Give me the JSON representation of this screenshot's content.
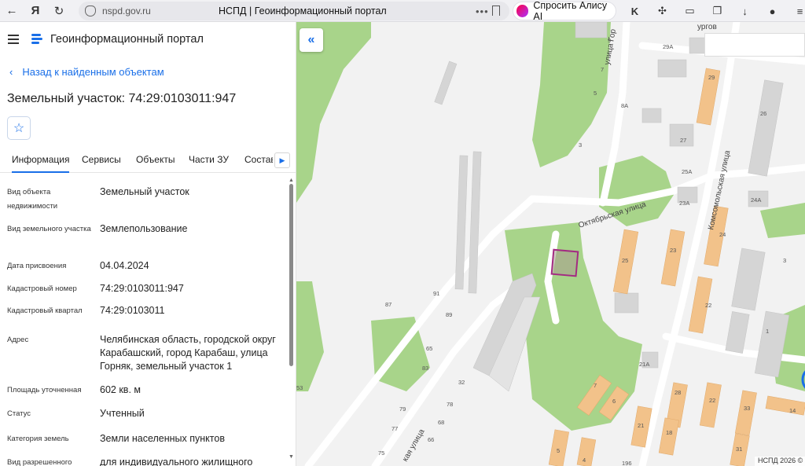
{
  "browser": {
    "url": "nspd.gov.ru",
    "tab_title": "НСПД | Геоинформационный портал",
    "alice_button": "Спросить Алису AI"
  },
  "header": {
    "title": "Геоинформационный портал"
  },
  "back_link": "Назад к найденным объектам",
  "object_title": "Земельный участок: 74:29:0103011:947",
  "tabs": [
    "Информация",
    "Сервисы",
    "Объекты",
    "Части ЗУ",
    "Состав"
  ],
  "fields": [
    {
      "label": "Вид объекта недвижимости",
      "value": "Земельный участок"
    },
    {
      "label": "Вид земельного участка",
      "value": "Землепользование"
    },
    {
      "label": "Дата присвоения",
      "value": "04.04.2024"
    },
    {
      "label": "Кадастровый номер",
      "value": "74:29:0103011:947"
    },
    {
      "label": "Кадастровый квартал",
      "value": "74:29:0103011"
    },
    {
      "label": "Адрес",
      "value": "Челябинская область, городской округ Карабашский, город Карабаш, улица Горняк, земельный участок 1"
    },
    {
      "label": "Площадь уточненная",
      "value": "602 кв. м"
    },
    {
      "label": "Статус",
      "value": "Учтенный"
    },
    {
      "label": "Категория земель",
      "value": "Земли населенных пунктов"
    },
    {
      "label": "Вид разрешенного",
      "value": "для индивидуального жилищного"
    }
  ],
  "map": {
    "streets": [
      "Октябрьская улица",
      "Комсомольская улица",
      "улица Гор",
      "кая улица",
      "ургов"
    ],
    "building_numbers": [
      "9",
      "7",
      "5",
      "8А",
      "3",
      "29А",
      "29",
      "26",
      "27",
      "25А",
      "23А",
      "24А",
      "24",
      "23",
      "25",
      "3",
      "22",
      "1",
      "21А",
      "7",
      "6",
      "28",
      "22",
      "33",
      "14",
      "21",
      "18",
      "31",
      "5",
      "4",
      "196",
      "91",
      "89",
      "87",
      "65",
      "83",
      "53",
      "32",
      "78",
      "79",
      "68",
      "77",
      "66",
      "75"
    ],
    "copyright": "НСПД 2026 ©",
    "colors": {
      "park": "#a8d48a",
      "residential": "#f2c28a",
      "building": "#d5d5d5",
      "parcel": "#a32b82"
    }
  }
}
